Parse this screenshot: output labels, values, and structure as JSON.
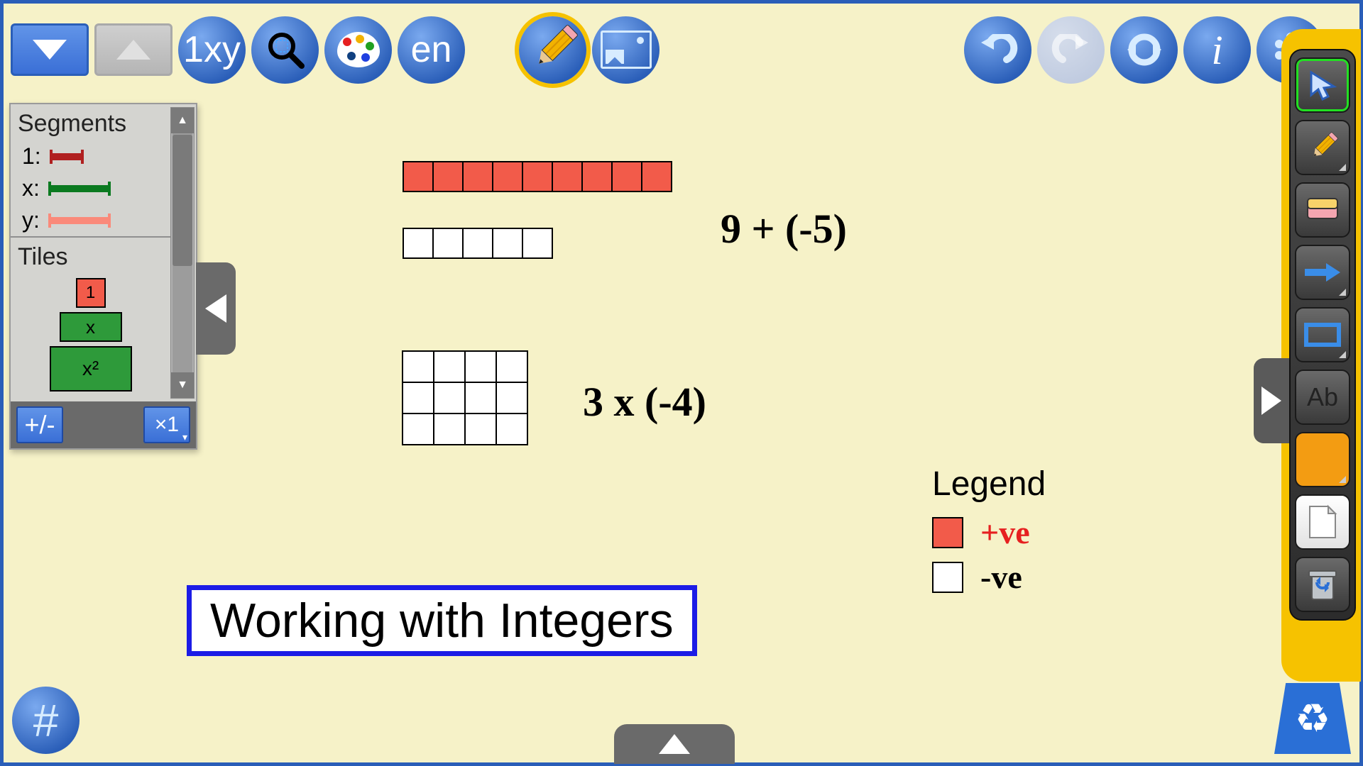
{
  "topbar": {
    "algebra_label": "1xy",
    "language_label": "en"
  },
  "palette": {
    "segments_title": "Segments",
    "seg1_label": "1:",
    "segx_label": "x:",
    "segy_label": "y:",
    "tiles_title": "Tiles",
    "tile1_label": "1",
    "tilex_label": "x",
    "tilex2_label": "x²",
    "footer_sign": "+/-",
    "footer_scale": "×1"
  },
  "canvas": {
    "expr1": "9 + (-5)",
    "expr2": "3 x (-4)",
    "title": "Working with Integers",
    "red_strip_count": 9,
    "white_strip_count": 5,
    "grid_rows": 3,
    "grid_cols": 4
  },
  "legend": {
    "title": "Legend",
    "pos_label": "+ve",
    "neg_label": "-ve"
  },
  "dock": {
    "text_tool_label": "Ab"
  },
  "bottom": {
    "hash": "#"
  }
}
